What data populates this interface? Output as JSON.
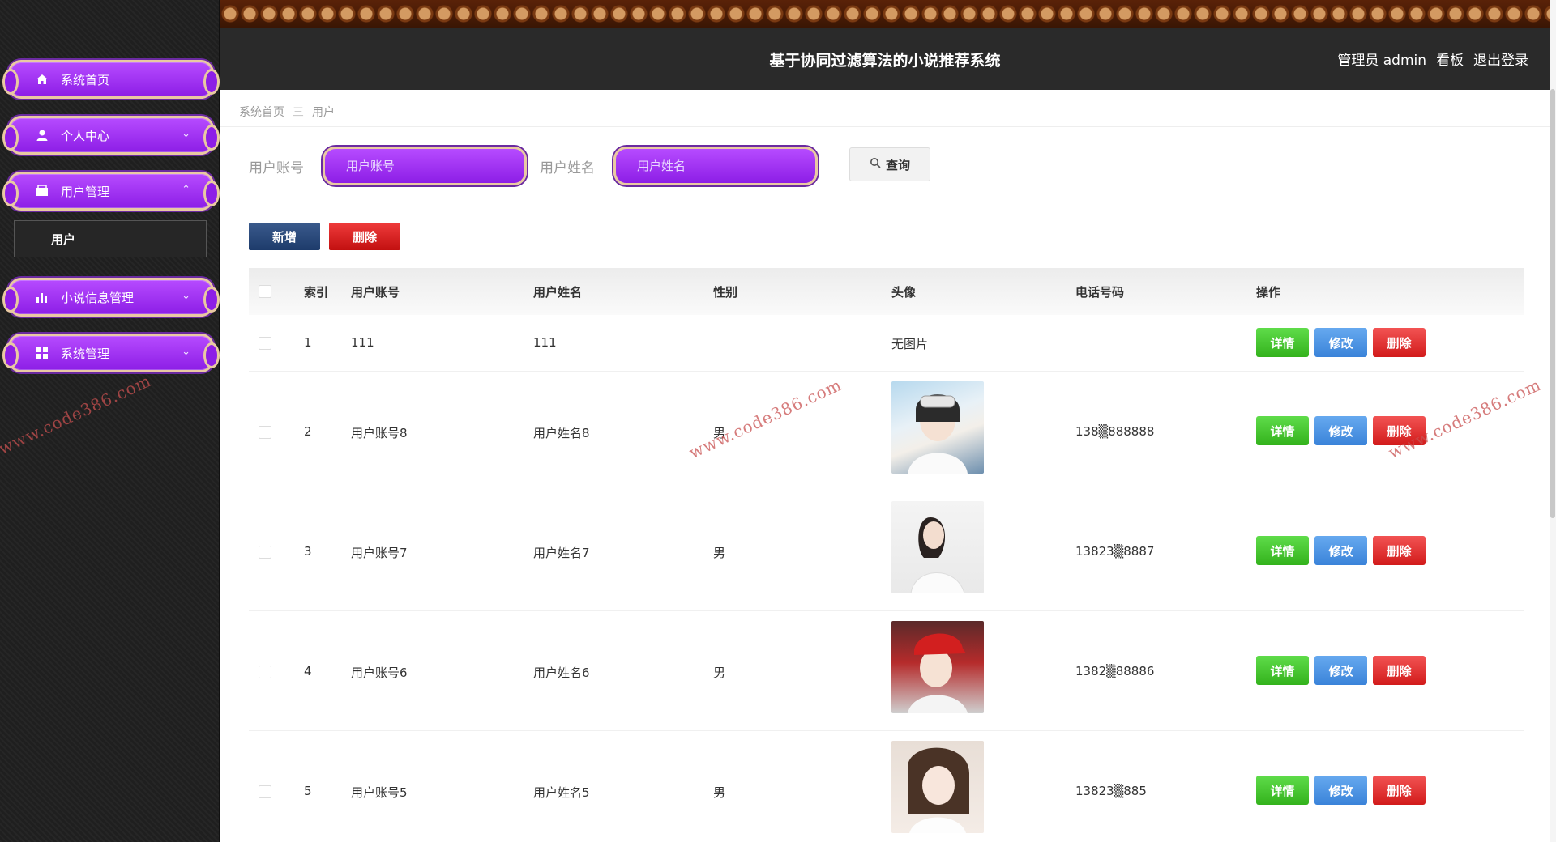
{
  "header": {
    "title": "基于协同过滤算法的小说推荐系统",
    "user_label": "管理员 admin",
    "board_label": "看板",
    "logout_label": "退出登录"
  },
  "sidebar": {
    "items": [
      {
        "label": "系统首页",
        "icon": "home-icon"
      },
      {
        "label": "个人中心",
        "icon": "user-icon",
        "arrow": "chevron-down"
      },
      {
        "label": "用户管理",
        "icon": "folder-icon",
        "arrow": "chevron-up"
      },
      {
        "label": "小说信息管理",
        "icon": "bar-chart-icon",
        "arrow": "chevron-down"
      },
      {
        "label": "系统管理",
        "icon": "grid-icon",
        "arrow": "chevron-down"
      }
    ],
    "submenu_label": "用户"
  },
  "breadcrumb": {
    "home": "系统首页",
    "separator": "三",
    "current": "用户"
  },
  "search": {
    "account_label": "用户账号",
    "account_placeholder": "用户账号",
    "name_label": "用户姓名",
    "name_placeholder": "用户姓名",
    "query_label": "查询"
  },
  "actions": {
    "add_label": "新增",
    "delete_label": "删除"
  },
  "table": {
    "columns": [
      "索引",
      "用户账号",
      "用户姓名",
      "性别",
      "头像",
      "电话号码",
      "操作"
    ],
    "rows": [
      {
        "index": "1",
        "account": "111",
        "name": "111",
        "gender": "",
        "avatar_text": "无图片",
        "phone": ""
      },
      {
        "index": "2",
        "account": "用户账号8",
        "name": "用户姓名8",
        "gender": "男",
        "avatar_text": "",
        "phone": "138▒888888"
      },
      {
        "index": "3",
        "account": "用户账号7",
        "name": "用户姓名7",
        "gender": "男",
        "avatar_text": "",
        "phone": "13823▒8887"
      },
      {
        "index": "4",
        "account": "用户账号6",
        "name": "用户姓名6",
        "gender": "男",
        "avatar_text": "",
        "phone": "1382▒88886"
      },
      {
        "index": "5",
        "account": "用户账号5",
        "name": "用户姓名5",
        "gender": "男",
        "avatar_text": "",
        "phone": "13823▒885"
      }
    ],
    "op_detail": "详情",
    "op_edit": "修改",
    "op_delete": "删除"
  },
  "watermark": "www.code386.com",
  "colors": {
    "menu_purple": "#9a2cf0",
    "detail_green": "#3fbf26",
    "edit_blue": "#4a90e2",
    "delete_red": "#dd2222"
  }
}
